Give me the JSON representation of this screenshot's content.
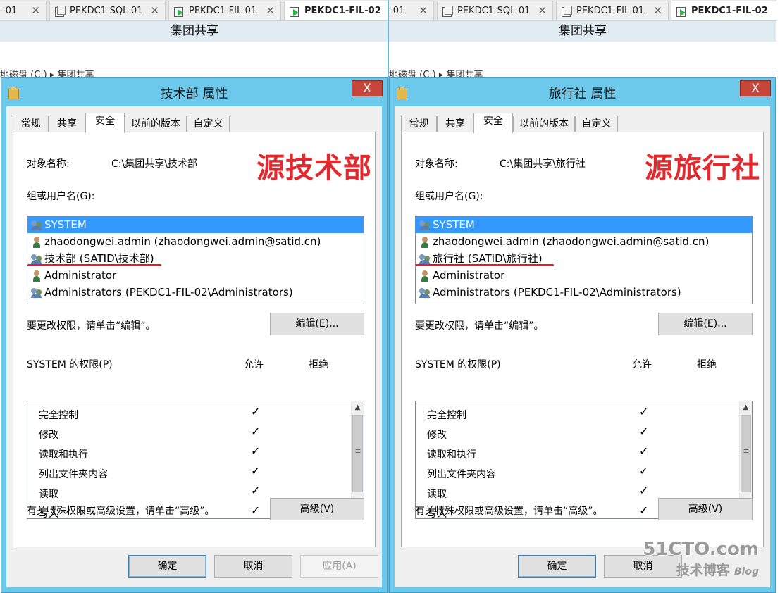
{
  "panels": [
    {
      "vm_tabs": [
        {
          "label": "-01",
          "state": "none",
          "active": false
        },
        {
          "label": "PEKDC1-SQL-01",
          "state": "stop",
          "active": false
        },
        {
          "label": "PEKDC1-FIL-01",
          "state": "run",
          "active": false
        },
        {
          "label": "PEKDC1-FIL-02",
          "state": "run",
          "active": true
        }
      ],
      "close_glyph": "✕",
      "group_title": "集团共享",
      "breadcrumb": "地磁盘 (C:)  ▸  集团共享",
      "dialog": {
        "title": "技术部 属性",
        "close_label": "X",
        "tabs": [
          "常规",
          "共享",
          "安全",
          "以前的版本",
          "自定义"
        ],
        "active_tab": "安全",
        "object_name_label": "对象名称:",
        "object_name_value": "C:\\集团共享\\技术部",
        "annotation": "源技术部",
        "group_label": "组或用户名(G):",
        "users": [
          {
            "icon": "group-icon",
            "name": "SYSTEM",
            "selected": true
          },
          {
            "icon": "user-icon",
            "name": "zhaodongwei.admin (zhaodongwei.admin@satid.cn)",
            "selected": false
          },
          {
            "icon": "group-icon",
            "name": "技术部 (SATID\\技术部)",
            "selected": false,
            "underlined": true
          },
          {
            "icon": "user-icon",
            "name": "Administrator",
            "selected": false
          },
          {
            "icon": "group-icon",
            "name": "Administrators (PEKDC1-FIL-02\\Administrators)",
            "selected": false
          }
        ],
        "change_hint": "要更改权限，请单击“编辑”。",
        "edit_button": "编辑(E)...",
        "perm_header": "SYSTEM 的权限(P)",
        "allow_header": "允许",
        "deny_header": "拒绝",
        "permissions": [
          {
            "name": "完全控制",
            "allow": "✓"
          },
          {
            "name": "修改",
            "allow": "✓"
          },
          {
            "name": "读取和执行",
            "allow": "✓"
          },
          {
            "name": "列出文件夹内容",
            "allow": "✓"
          },
          {
            "name": "读取",
            "allow": "✓"
          },
          {
            "name": "写入",
            "allow": "✓"
          }
        ],
        "advanced_hint": "有关特殊权限或高级设置，请单击“高级”。",
        "advanced_button": "高级(V)",
        "ok_button": "确定",
        "cancel_button": "取消",
        "apply_button": "应用(A)"
      }
    },
    {
      "vm_tabs": [
        {
          "label": "-01",
          "state": "none",
          "active": false
        },
        {
          "label": "PEKDC1-SQL-01",
          "state": "stop",
          "active": false
        },
        {
          "label": "PEKDC1-FIL-01",
          "state": "stop",
          "active": false
        },
        {
          "label": "PEKDC1-FIL-02",
          "state": "run",
          "active": true
        }
      ],
      "close_glyph": "✕",
      "group_title": "集团共享",
      "breadcrumb": "地磁盘 (C:)  ▸  集团共享",
      "dialog": {
        "title": "旅行社 属性",
        "close_label": "X",
        "tabs": [
          "常规",
          "共享",
          "安全",
          "以前的版本",
          "自定义"
        ],
        "active_tab": "安全",
        "object_name_label": "对象名称:",
        "object_name_value": "C:\\集团共享\\旅行社",
        "annotation": "源旅行社",
        "group_label": "组或用户名(G):",
        "users": [
          {
            "icon": "group-icon",
            "name": "SYSTEM",
            "selected": true
          },
          {
            "icon": "user-icon",
            "name": "zhaodongwei.admin (zhaodongwei.admin@satid.cn)",
            "selected": false
          },
          {
            "icon": "group-icon",
            "name": "旅行社 (SATID\\旅行社)",
            "selected": false,
            "underlined": true
          },
          {
            "icon": "user-icon",
            "name": "Administrator",
            "selected": false
          },
          {
            "icon": "group-icon",
            "name": "Administrators (PEKDC1-FIL-02\\Administrators)",
            "selected": false
          }
        ],
        "change_hint": "要更改权限，请单击“编辑”。",
        "edit_button": "编辑(E)...",
        "perm_header": "SYSTEM 的权限(P)",
        "allow_header": "允许",
        "deny_header": "拒绝",
        "permissions": [
          {
            "name": "完全控制",
            "allow": "✓"
          },
          {
            "name": "修改",
            "allow": "✓"
          },
          {
            "name": "读取和执行",
            "allow": "✓"
          },
          {
            "name": "列出文件夹内容",
            "allow": "✓"
          },
          {
            "name": "读取",
            "allow": "✓"
          },
          {
            "name": "写入",
            "allow": "✓"
          }
        ],
        "advanced_hint": "有关特殊权限或高级设置，请单击“高级”。",
        "advanced_button": "高级(V)",
        "ok_button": "确定",
        "cancel_button": "取消"
      }
    }
  ],
  "watermark": {
    "site": "51CTO.com",
    "tagline": "技术博客",
    "blog": "Blog"
  }
}
